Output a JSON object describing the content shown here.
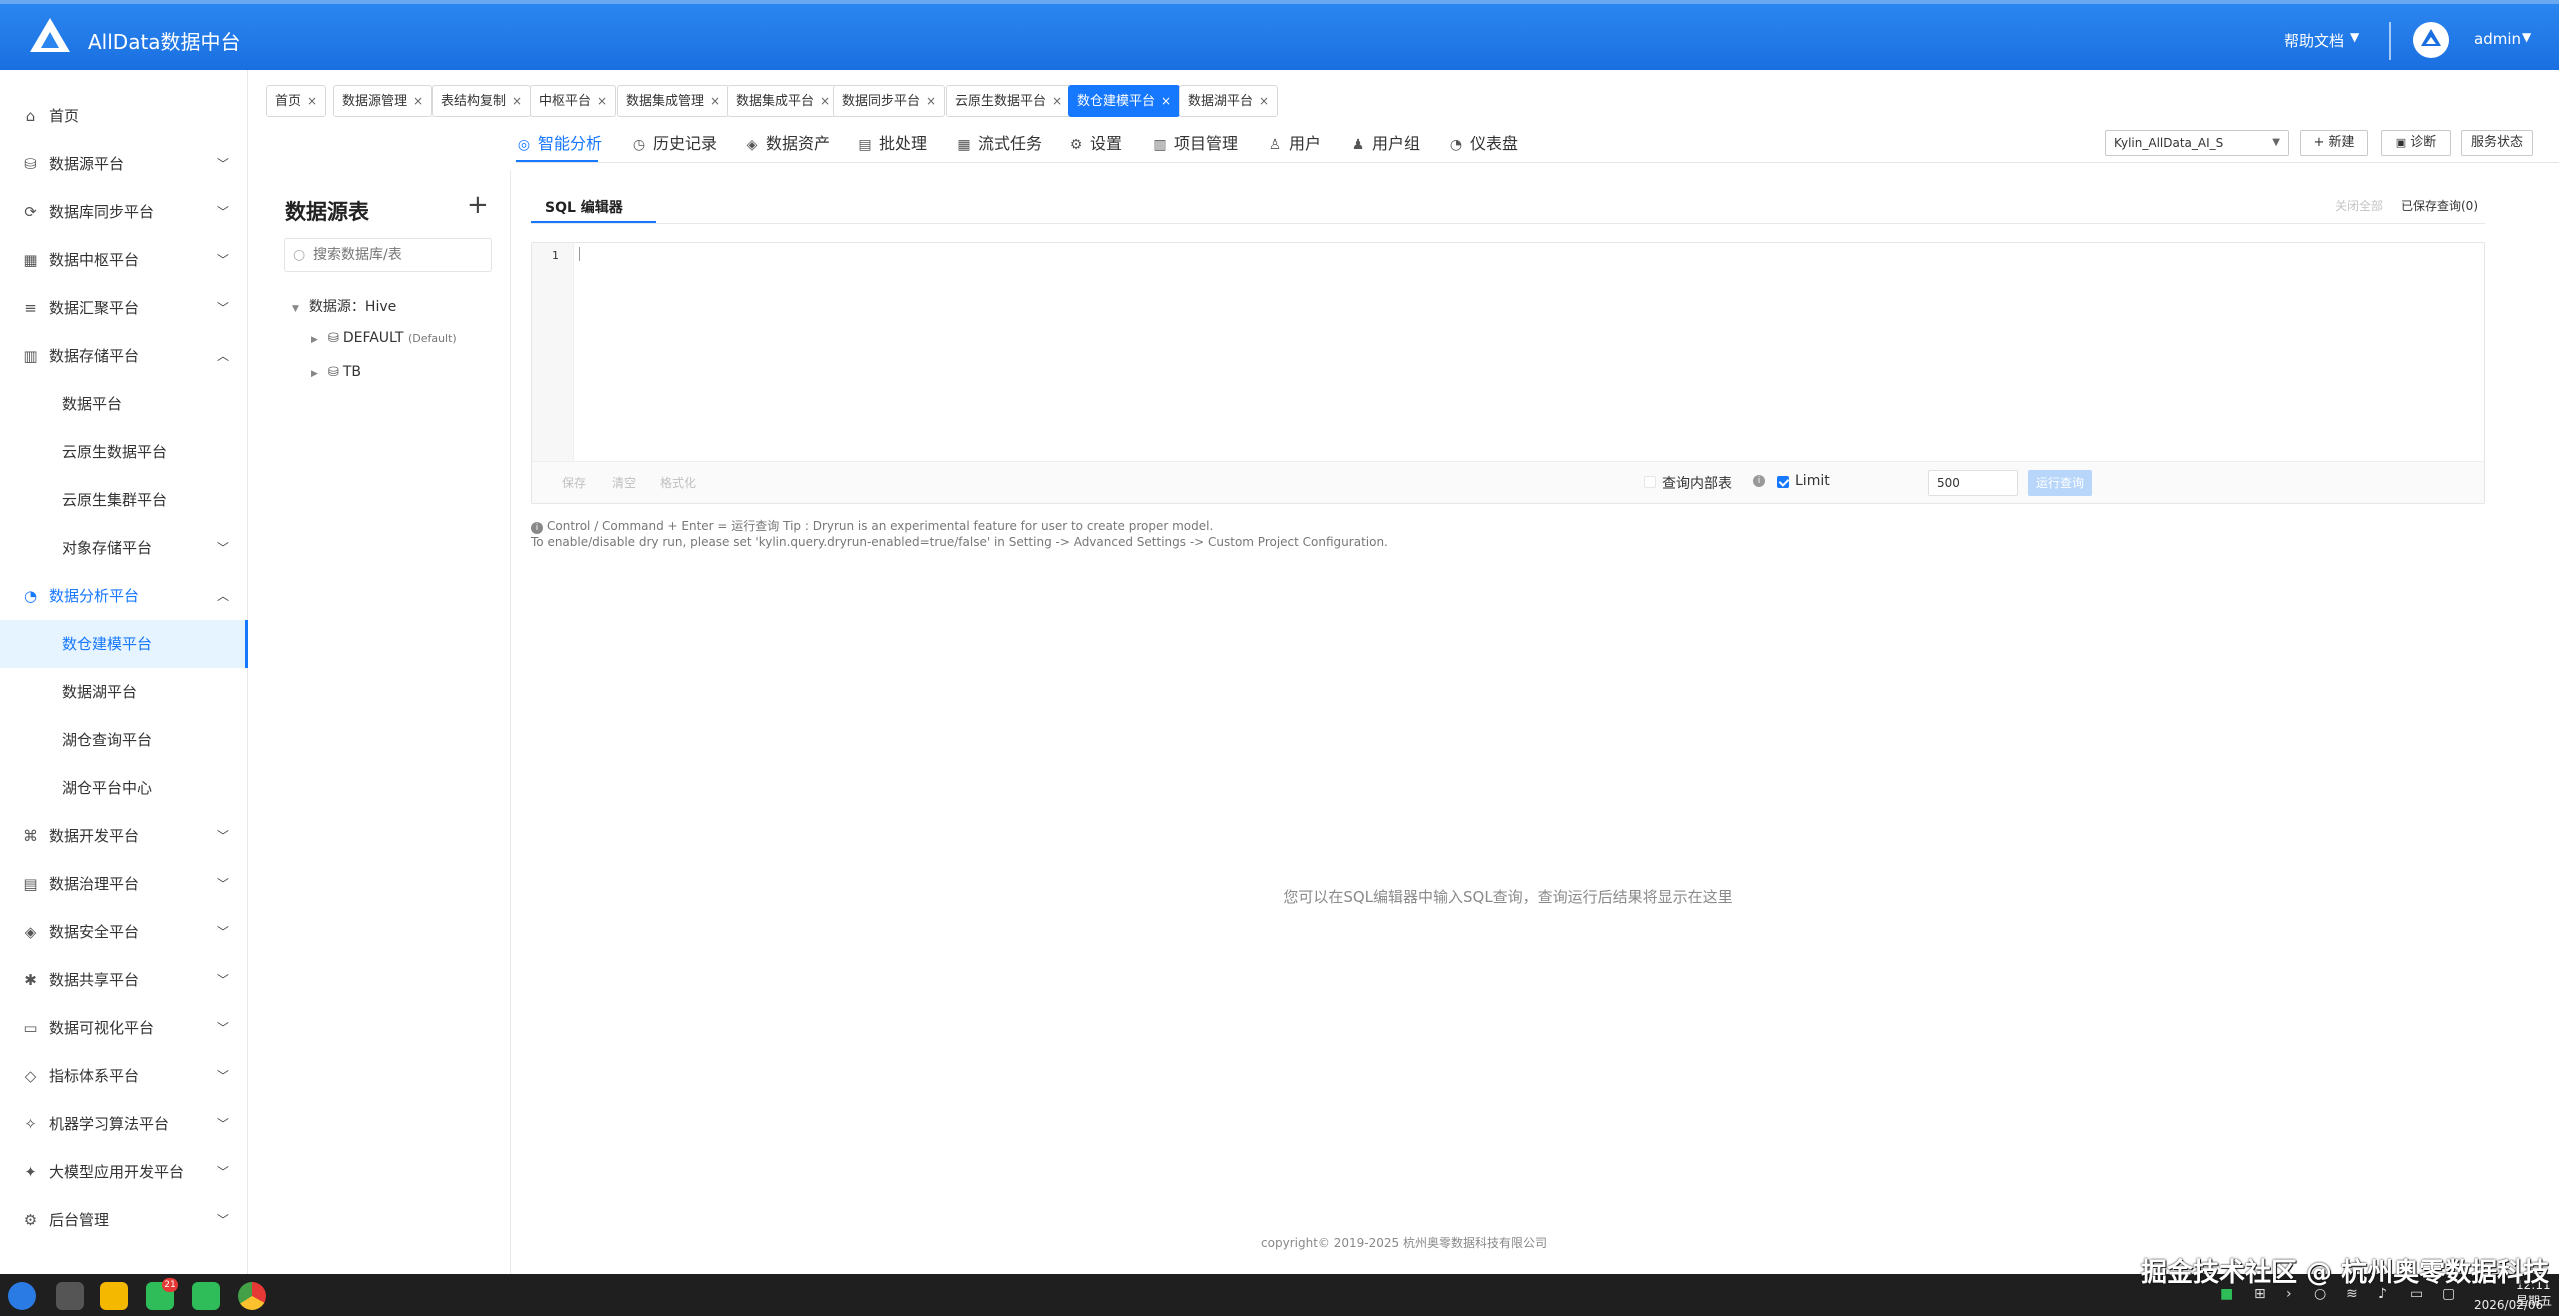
{
  "header": {
    "brand": "AllData数据中台",
    "help": "帮助文档",
    "user": "admin"
  },
  "sidebar": {
    "items": [
      {
        "label": "首页",
        "icon": "home-icon",
        "has_arrow": false
      },
      {
        "label": "数据源平台",
        "icon": "database-icon",
        "has_arrow": true
      },
      {
        "label": "数据库同步平台",
        "icon": "sync-icon",
        "has_arrow": true
      },
      {
        "label": "数据中枢平台",
        "icon": "hub-icon",
        "has_arrow": true
      },
      {
        "label": "数据汇聚平台",
        "icon": "layers-icon",
        "has_arrow": true
      },
      {
        "label": "数据存储平台",
        "icon": "storage-icon",
        "has_arrow": true,
        "expanded": true
      },
      {
        "label": "数据平台",
        "sub": true
      },
      {
        "label": "云原生数据平台",
        "sub": true
      },
      {
        "label": "云原生集群平台",
        "sub": true
      },
      {
        "label": "对象存储平台",
        "sub": true,
        "has_arrow": true
      },
      {
        "label": "数据分析平台",
        "icon": "analysis-icon",
        "has_arrow": true,
        "expanded": true,
        "active_parent": true
      },
      {
        "label": "数仓建模平台",
        "sub": true,
        "selected": true
      },
      {
        "label": "数据湖平台",
        "sub": true
      },
      {
        "label": "湖仓查询平台",
        "sub": true
      },
      {
        "label": "湖仓平台中心",
        "sub": true
      },
      {
        "label": "数据开发平台",
        "icon": "dev-icon",
        "has_arrow": true
      },
      {
        "label": "数据治理平台",
        "icon": "governance-icon",
        "has_arrow": true
      },
      {
        "label": "数据安全平台",
        "icon": "security-icon",
        "has_arrow": true
      },
      {
        "label": "数据共享平台",
        "icon": "share-icon",
        "has_arrow": true
      },
      {
        "label": "数据可视化平台",
        "icon": "monitor-icon",
        "has_arrow": true
      },
      {
        "label": "指标体系平台",
        "icon": "metrics-icon",
        "has_arrow": true
      },
      {
        "label": "机器学习算法平台",
        "icon": "ml-icon",
        "has_arrow": true
      },
      {
        "label": "大模型应用开发平台",
        "icon": "llm-icon",
        "has_arrow": true
      },
      {
        "label": "后台管理",
        "icon": "admin-icon",
        "has_arrow": true
      }
    ]
  },
  "tabs": [
    {
      "label": "首页"
    },
    {
      "label": "数据源管理"
    },
    {
      "label": "表结构复制"
    },
    {
      "label": "中枢平台"
    },
    {
      "label": "数据集成管理"
    },
    {
      "label": "数据集成平台"
    },
    {
      "label": "数据同步平台"
    },
    {
      "label": "云原生数据平台"
    },
    {
      "label": "数仓建模平台",
      "active": true
    },
    {
      "label": "数据湖平台"
    }
  ],
  "subnav": [
    {
      "label": "智能分析",
      "icon": "analysis-icon",
      "active": true
    },
    {
      "label": "历史记录",
      "icon": "history-icon"
    },
    {
      "label": "数据资产",
      "icon": "asset-icon"
    },
    {
      "label": "批处理",
      "icon": "batch-icon"
    },
    {
      "label": "流式任务",
      "icon": "stream-icon"
    },
    {
      "label": "设置",
      "icon": "settings-icon"
    },
    {
      "label": "项目管理",
      "icon": "project-icon"
    },
    {
      "label": "用户",
      "icon": "user-icon"
    },
    {
      "label": "用户组",
      "icon": "user-group-icon"
    },
    {
      "label": "仪表盘",
      "icon": "dashboard-icon"
    }
  ],
  "toolbar": {
    "project": "Kylin_AllData_AI_S",
    "new_label": "+ 新建",
    "diagnose_label": "诊断",
    "status_label": "服务状态"
  },
  "datasource": {
    "title": "数据源表",
    "search_placeholder": "搜索数据库/表",
    "root": "数据源：Hive",
    "children": [
      {
        "name": "DEFAULT",
        "tag": "(Default)"
      },
      {
        "name": "TB",
        "tag": ""
      }
    ]
  },
  "editor": {
    "tab_label": "SQL 编辑器",
    "close_all": "关闭全部",
    "saved_queries": "已保存查询(0)",
    "line_number": "1",
    "save": "保存",
    "clear": "清空",
    "format": "格式化",
    "internal_table": "查询内部表",
    "limit_label": "Limit",
    "limit_value": "500",
    "run": "运行查询",
    "tip1": "Control / Command + Enter = 运行查询 Tip : Dryrun is an experimental feature for user to create proper model.",
    "tip2": "To enable/disable dry run, please set 'kylin.query.dryrun-enabled=true/false' in Setting -> Advanced Settings -> Custom Project Configuration.",
    "empty_text": "您可以在SQL编辑器中输入SQL查询，查询运行后结果将显示在这里"
  },
  "footer": {
    "copyright": "copyright© 2019-2025 杭州奥零数据科技有限公司"
  },
  "taskbar": {
    "badge": "21",
    "time": "12:11 星期五",
    "date": "2026/02/06"
  },
  "watermark": "掘金技术社区 @ 杭州奥零数据科技",
  "colors": {
    "primary": "#1677ff",
    "header": "#1a6fe0",
    "taskbar": "#1f1f1f"
  }
}
